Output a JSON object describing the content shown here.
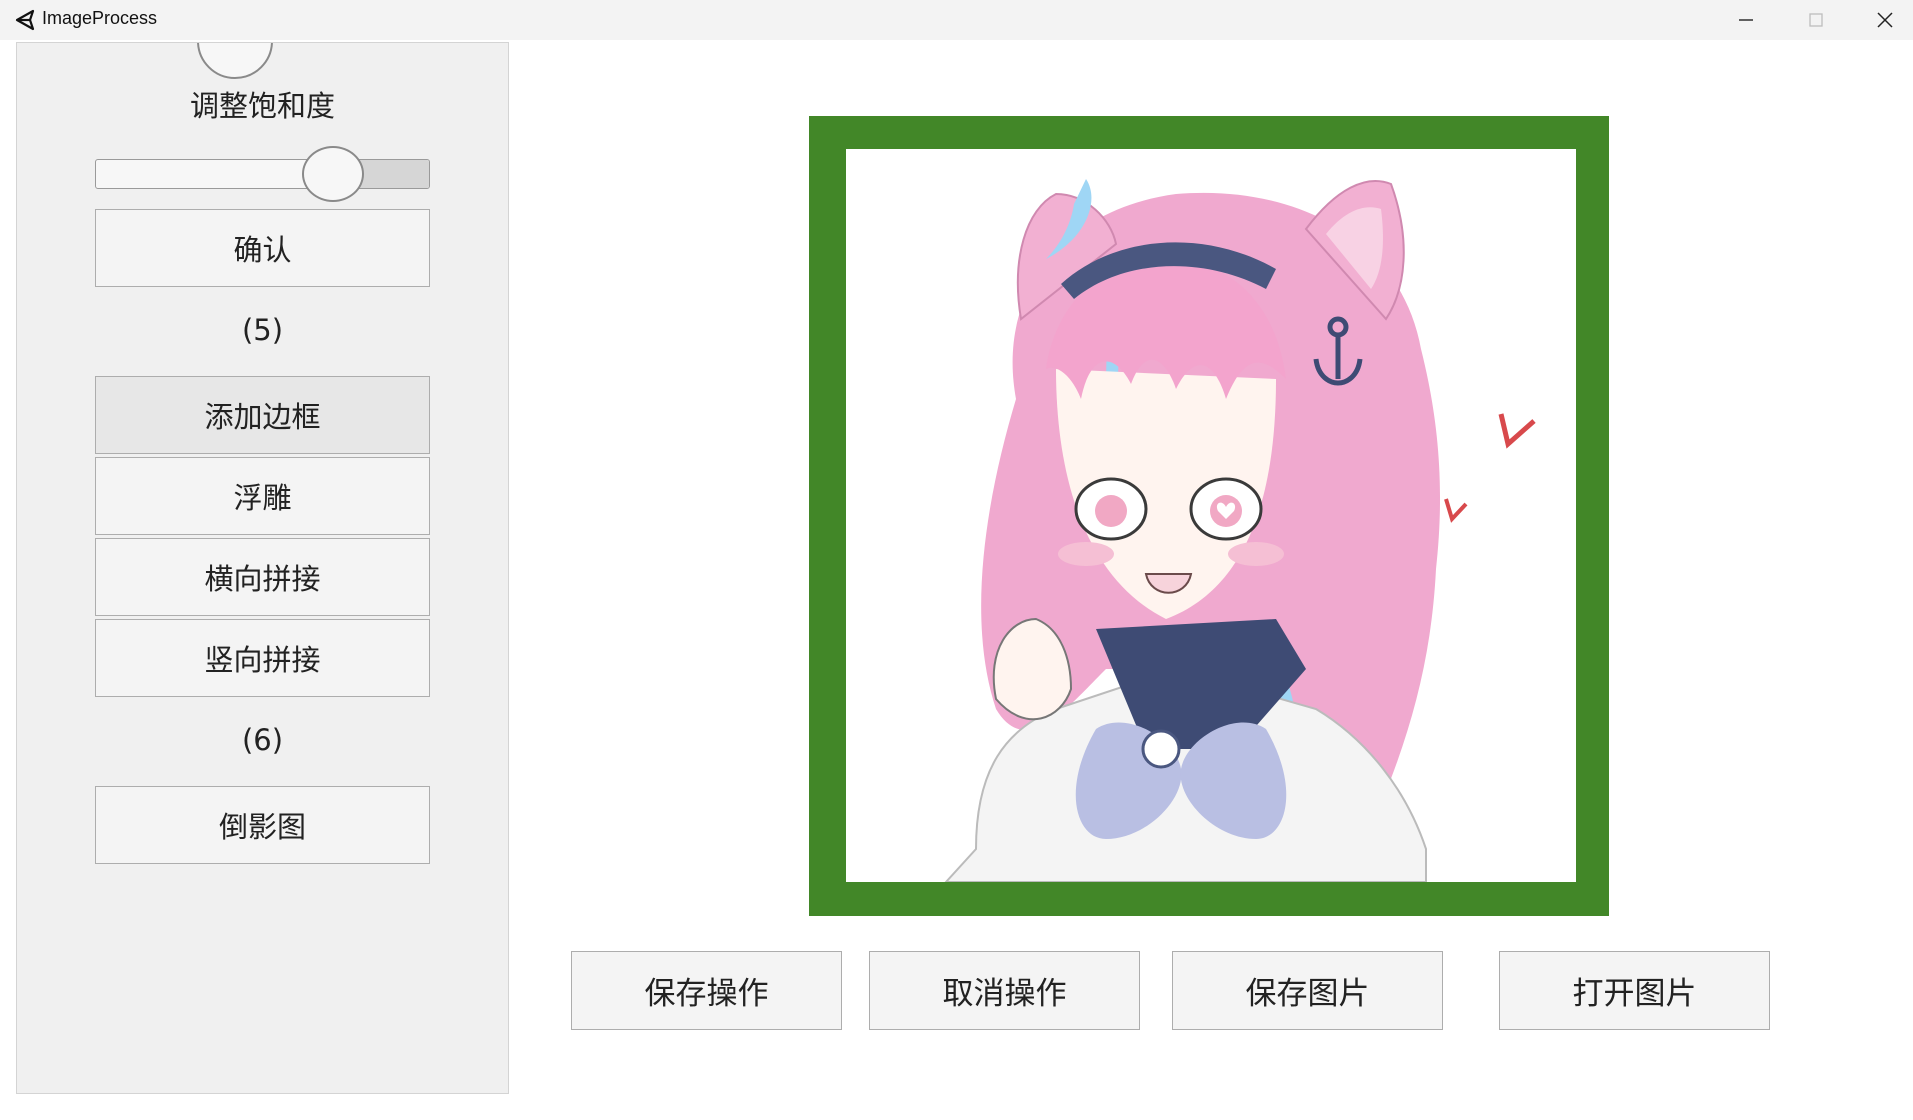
{
  "window": {
    "title": "ImageProcess",
    "icons": {
      "app": "unity-logo-icon",
      "minimize": "minimize-icon",
      "maximize": "maximize-icon",
      "close": "close-icon"
    }
  },
  "sidebar": {
    "saturation_label": "调整饱和度",
    "saturation_slider": {
      "value": 0.71
    },
    "confirm_label": "确认",
    "section5_label": "(5)",
    "add_border_label": "添加边框",
    "emboss_label": "浮雕",
    "horizontal_stitch_label": "横向拼接",
    "vertical_stitch_label": "竖向拼接",
    "section6_label": "(6)",
    "reflection_label": "倒影图"
  },
  "preview": {
    "border_color": "#428728",
    "image": "anime-girl-illustration"
  },
  "actions": {
    "save_operation_label": "保存操作",
    "cancel_operation_label": "取消操作",
    "save_image_label": "保存图片",
    "open_image_label": "打开图片"
  }
}
